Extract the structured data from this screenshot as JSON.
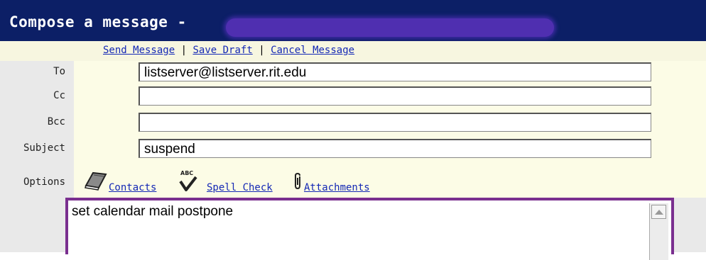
{
  "window": {
    "title": "Compose a message -"
  },
  "actions": {
    "send": "Send Message",
    "save_draft": "Save Draft",
    "cancel": "Cancel Message",
    "separator": "|"
  },
  "fields": {
    "to": {
      "label": "To",
      "value": "listserver@listserver.rit.edu"
    },
    "cc": {
      "label": "Cc",
      "value": ""
    },
    "bcc": {
      "label": "Bcc",
      "value": ""
    },
    "subject": {
      "label": "Subject",
      "value": "suspend"
    }
  },
  "options": {
    "label": "Options",
    "contacts": {
      "label": "Contacts",
      "icon": "address-book-icon"
    },
    "spell_check": {
      "label": "Spell Check",
      "icon": "spell-check-icon",
      "icon_text": "ABC"
    },
    "attachments": {
      "label": "Attachments",
      "icon": "paperclip-icon"
    }
  },
  "body": {
    "text": "set calendar mail postpone"
  },
  "colors": {
    "title_bar": "#0c1f66",
    "link": "#1428b5",
    "body_border": "#7a2f8f",
    "field_area": "#fcfce6"
  }
}
